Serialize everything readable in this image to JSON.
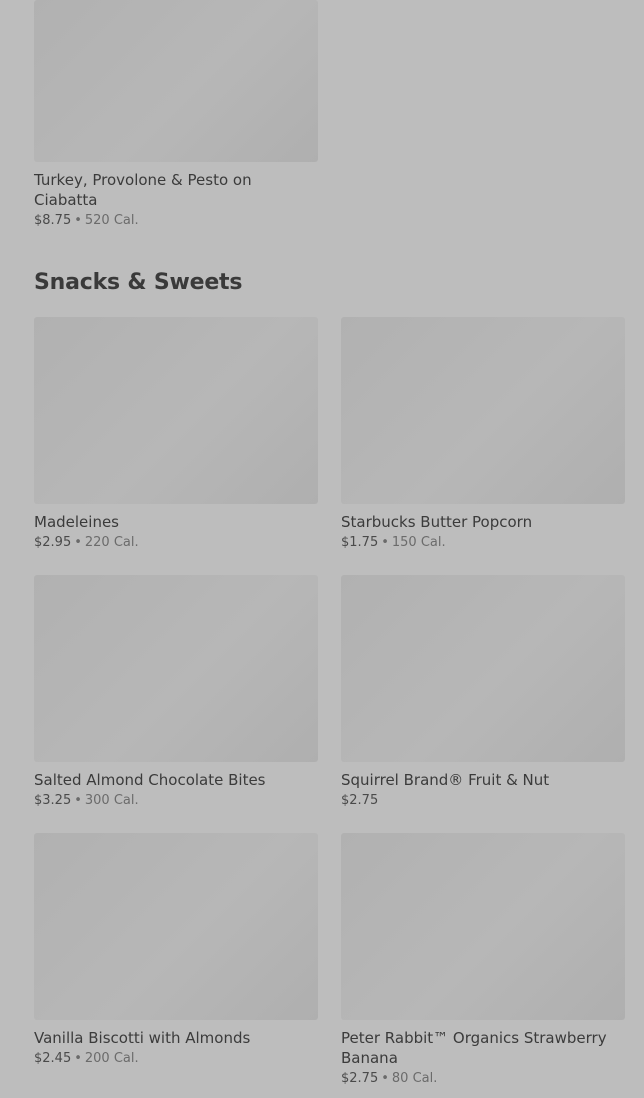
{
  "sections": {
    "sandwiches": {
      "items": [
        {
          "name": "Turkey, Provolone & Pesto on Ciabatta",
          "price": "$8.75",
          "separator": "•",
          "calories": "520 Cal."
        }
      ]
    },
    "snacks_sweets": {
      "title": "Snacks & Sweets",
      "items": [
        {
          "name": "Madeleines",
          "price": "$2.95",
          "separator": "•",
          "calories": "220 Cal."
        },
        {
          "name": "Starbucks Butter Popcorn",
          "price": "$1.75",
          "separator": "•",
          "calories": "150 Cal."
        },
        {
          "name": "Salted Almond Chocolate Bites",
          "price": "$3.25",
          "separator": "•",
          "calories": "300 Cal."
        },
        {
          "name": "Squirrel Brand® Fruit & Nut",
          "price": "$2.75"
        },
        {
          "name": "Vanilla Biscotti with Almonds",
          "price": "$2.45",
          "separator": "•",
          "calories": "200 Cal."
        },
        {
          "name": "Peter Rabbit™ Organics Strawberry Banana",
          "price": "$2.75",
          "separator": "•",
          "calories": "80 Cal."
        }
      ]
    }
  }
}
